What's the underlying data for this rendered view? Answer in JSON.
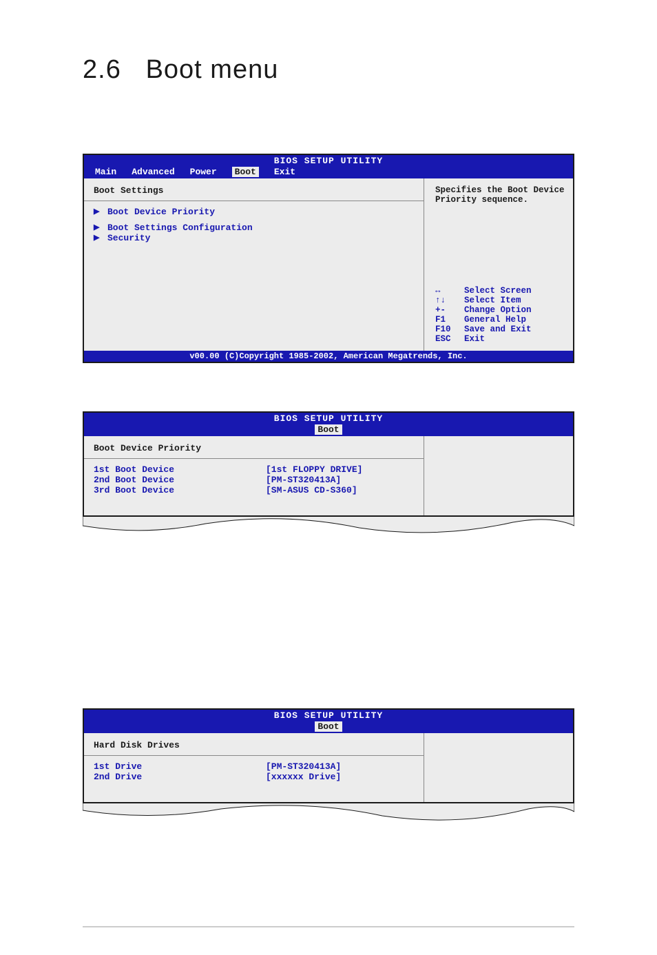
{
  "page_header": {
    "number": "2.6",
    "title": "Boot menu"
  },
  "bios1": {
    "title": "BIOS SETUP UTILITY",
    "menu": [
      "Main",
      "Advanced",
      "Power",
      "Boot",
      "Exit"
    ],
    "selected_index": 3,
    "heading": "Boot Settings",
    "items": [
      "Boot Device Priority",
      "Boot Settings Configuration",
      "Security"
    ],
    "help_text": "Specifies the Boot Device Priority sequence.",
    "nav": [
      {
        "key": "↔",
        "label": "Select Screen"
      },
      {
        "key": "↑↓",
        "label": "Select Item"
      },
      {
        "key": "+-",
        "label": "Change Option"
      },
      {
        "key": "F1",
        "label": "General Help"
      },
      {
        "key": "F10",
        "label": "Save and Exit"
      },
      {
        "key": "ESC",
        "label": "Exit"
      }
    ],
    "footer": "v00.00 (C)Copyright 1985-2002, American Megatrends, Inc."
  },
  "bios2": {
    "title": "BIOS SETUP UTILITY",
    "selected_tab": "Boot",
    "heading": "Boot Device Priority",
    "rows": [
      {
        "label": "1st Boot Device",
        "value": "[1st FLOPPY DRIVE]"
      },
      {
        "label": "2nd Boot Device",
        "value": "[PM-ST320413A]"
      },
      {
        "label": "3rd Boot Device",
        "value": "[SM-ASUS CD-S360]"
      }
    ]
  },
  "bios3": {
    "title": "BIOS SETUP UTILITY",
    "selected_tab": "Boot",
    "heading": "Hard Disk Drives",
    "rows": [
      {
        "label": "1st Drive",
        "value": "[PM-ST320413A]"
      },
      {
        "label": "2nd Drive",
        "value": "[xxxxxx Drive]"
      }
    ]
  }
}
